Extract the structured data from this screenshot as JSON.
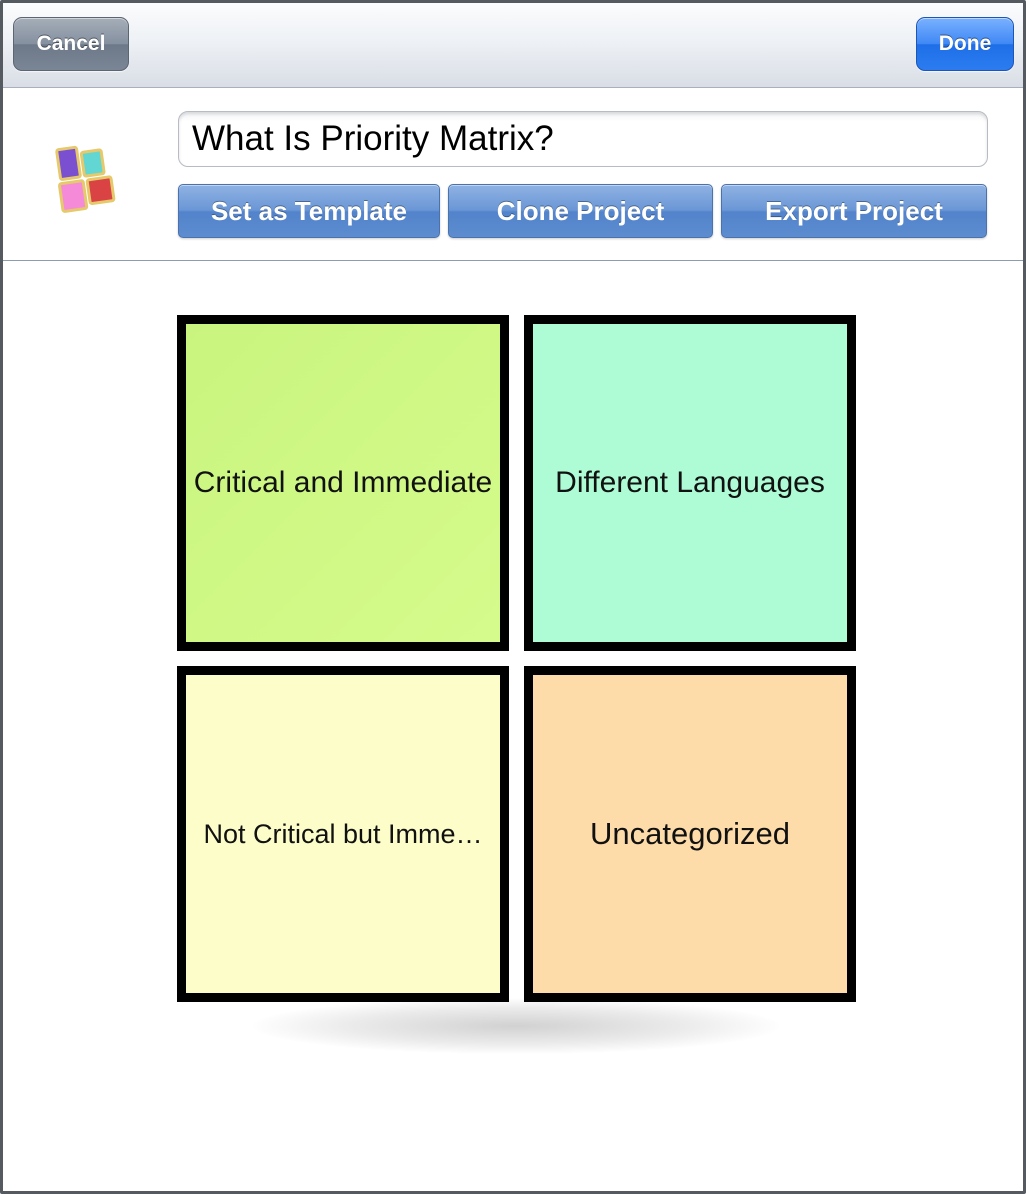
{
  "navbar": {
    "cancel_label": "Cancel",
    "done_label": "Done"
  },
  "project": {
    "title": "What Is Priority Matrix?",
    "logo_icon": "priority-matrix-logo-icon"
  },
  "actions": {
    "set_template_label": "Set as Template",
    "clone_label": "Clone Project",
    "export_label": "Export Project"
  },
  "quadrants": [
    {
      "label": "Critical and Immediate",
      "color": "#d0fa86"
    },
    {
      "label": "Different Languages",
      "color": "#aefcd5"
    },
    {
      "label": "Not Critical but Imme…",
      "color": "#fdfdc9"
    },
    {
      "label": "Uncategorized",
      "color": "#fedcaa"
    }
  ],
  "colors": {
    "done_button": "#2c7cf0",
    "cancel_button": "#7a8595",
    "action_button": "#5d8ccf"
  }
}
